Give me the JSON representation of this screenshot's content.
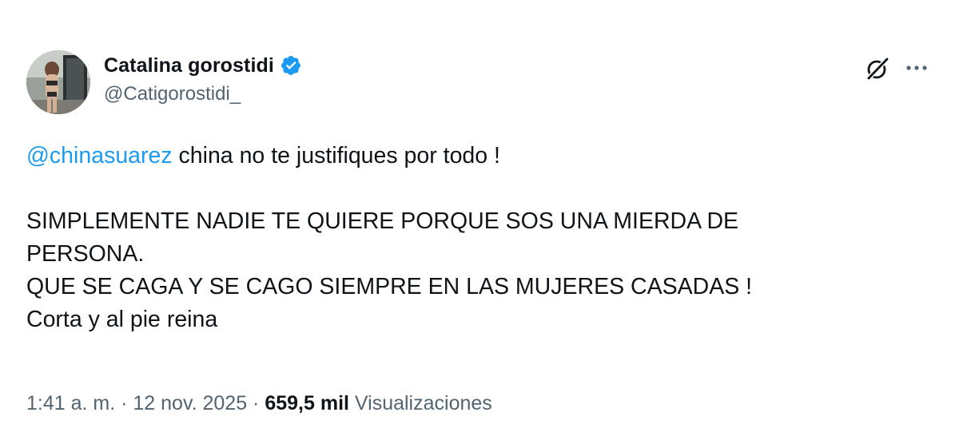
{
  "author": {
    "display_name": "Catalina gorostidi",
    "handle": "@Catigorostidi_",
    "verified": true
  },
  "post": {
    "mention": "@chinasuarez",
    "line1_rest": " china no te justifiques por todo !",
    "line2": "SIMPLEMENTE NADIE TE QUIERE PORQUE SOS UNA MIERDA DE",
    "line3": "PERSONA.",
    "line4": "QUE SE CAGA Y SE CAGO SIEMPRE EN LAS MUJERES CASADAS !",
    "line5": "Corta y al pie reina"
  },
  "meta": {
    "time": "1:41 a. m.",
    "separator1": " · ",
    "date": "12 nov. 2025",
    "separator2": " · ",
    "views_count": "659,5 mil",
    "views_label": " Visualizaciones"
  },
  "icons": {
    "verified": "verified-badge-icon",
    "grok": "grok-icon",
    "more": "more-options-icon"
  },
  "colors": {
    "accent": "#1d9bf0",
    "text": "#0f1419",
    "secondary": "#536471"
  }
}
